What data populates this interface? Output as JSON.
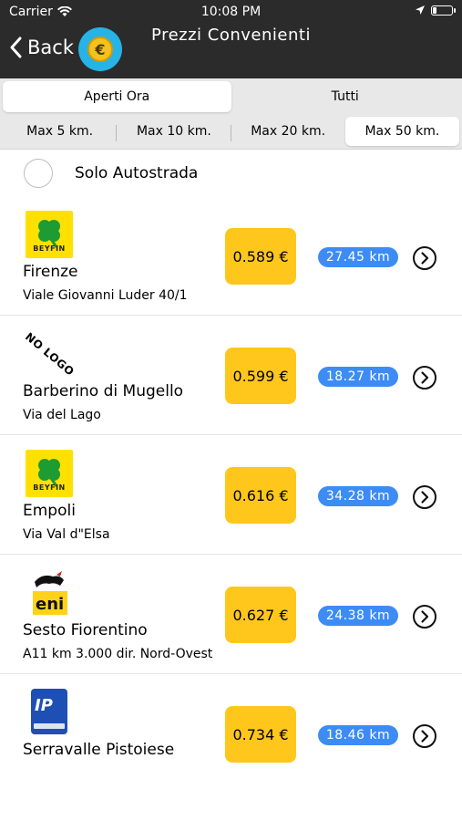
{
  "status_bar": {
    "carrier": "Carrier",
    "time": "10:08 PM",
    "battery_level": 0.2
  },
  "nav": {
    "back_label": "Back",
    "title": "Prezzi Convenienti",
    "badge_symbol": "€"
  },
  "filter_open": {
    "options": [
      "Aperti Ora",
      "Tutti"
    ],
    "selected": "Aperti Ora"
  },
  "filter_distance": {
    "options": [
      "Max 5 km.",
      "Max 10 km.",
      "Max 20 km.",
      "Max 50 km."
    ],
    "selected": "Max 50 km."
  },
  "highway": {
    "label": "Solo Autostrada",
    "checked": false
  },
  "stations": [
    {
      "brand": "beyfin",
      "brand_text": "BEYFIN",
      "city": "Firenze",
      "address": "Viale Giovanni Luder 40/1",
      "price": "0.589 €",
      "distance": "27.45 km"
    },
    {
      "brand": "nologo",
      "brand_text": "NO LOGO",
      "city": "Barberino di Mugello",
      "address": "Via del Lago",
      "price": "0.599 €",
      "distance": "18.27 km"
    },
    {
      "brand": "beyfin",
      "brand_text": "BEYFIN",
      "city": "Empoli",
      "address": "Via Val d\"Elsa",
      "price": "0.616 €",
      "distance": "34.28 km"
    },
    {
      "brand": "eni",
      "brand_text": "eni",
      "city": "Sesto Fiorentino",
      "address": "A11 km 3.000 dir. Nord-Ovest",
      "price": "0.627 €",
      "distance": "24.38 km"
    },
    {
      "brand": "ip",
      "brand_text": "IP",
      "city": "Serravalle Pistoiese",
      "address": "",
      "price": "0.734 €",
      "distance": "18.46 km"
    }
  ],
  "colors": {
    "price_bg": "#ffc71c",
    "distance_bg": "#3d8cf5",
    "nav_bg": "#2b2b2b",
    "badge_bg": "#27b3e6"
  }
}
